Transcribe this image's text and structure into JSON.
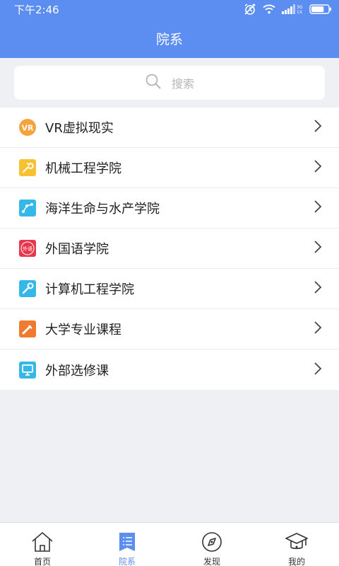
{
  "status_bar": {
    "time": "下午2:46",
    "battery_level": 0.75
  },
  "header": {
    "title": "院系"
  },
  "search": {
    "placeholder": "搜索"
  },
  "departments": [
    {
      "label": "VR虚拟现实",
      "icon": "vr-icon",
      "color": "#f6a33c"
    },
    {
      "label": "机械工程学院",
      "icon": "wrench-icon",
      "color": "#f7c232"
    },
    {
      "label": "海洋生命与水产学院",
      "icon": "network-icon",
      "color": "#35b7e8"
    },
    {
      "label": "外国语学院",
      "icon": "foreign-language-icon",
      "color": "#e8374d"
    },
    {
      "label": "计算机工程学院",
      "icon": "tools-icon",
      "color": "#35b7e8"
    },
    {
      "label": "大学专业课程",
      "icon": "spanner-icon",
      "color": "#f07a2e"
    },
    {
      "label": "外部选修课",
      "icon": "monitor-icon",
      "color": "#35b7e8"
    }
  ],
  "foreign_icon_text": "外语",
  "tabs": [
    {
      "label": "首页",
      "icon": "home-icon",
      "active": false
    },
    {
      "label": "院系",
      "icon": "list-icon",
      "active": true
    },
    {
      "label": "发现",
      "icon": "compass-icon",
      "active": false
    },
    {
      "label": "我的",
      "icon": "graduation-cap-icon",
      "active": false
    }
  ],
  "colors": {
    "accent": "#5b8ef0",
    "background": "#eff0f4"
  }
}
